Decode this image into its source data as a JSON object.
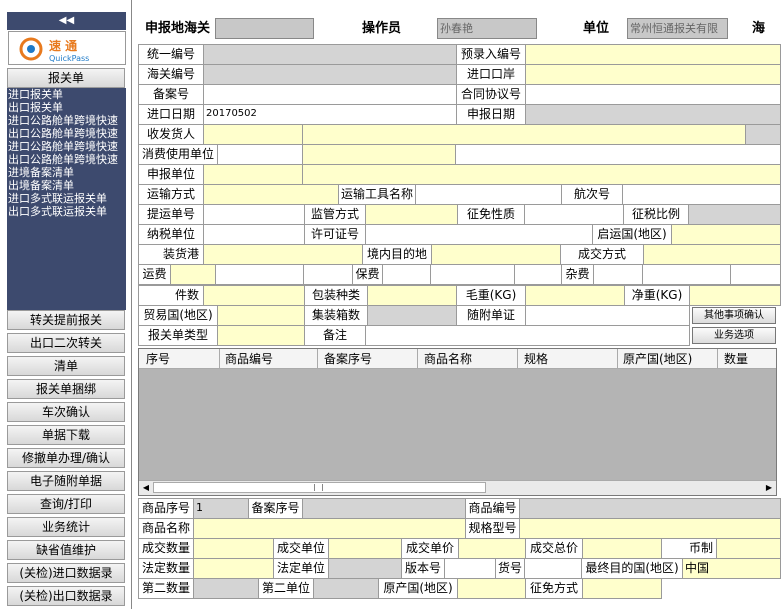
{
  "sidebar": {
    "collapse": "◀◀",
    "logo": {
      "cn": "速 通",
      "en": "QuickPass"
    },
    "section": "报关单",
    "nav_items": [
      "进口报关单",
      "出口报关单",
      "进口公路舱单跨境快速",
      "出口公路舱单跨境快速",
      "进口公路舱单跨境快速",
      "出口公路舱单跨境快速",
      "进境备案清单",
      "出境备案清单",
      "进口多式联运报关单",
      "出口多式联运报关单"
    ],
    "buttons": [
      "转关提前报关",
      "出口二次转关",
      "清单",
      "报关单捆绑",
      "车次确认",
      "单据下载",
      "修撤单办理/确认",
      "电子随附单据",
      "查询/打印",
      "业务统计",
      "缺省值维护",
      "(关检)进口数据录",
      "(关检)出口数据录"
    ]
  },
  "header": {
    "customs_label": "申报地海关",
    "customs_value": "",
    "operator_label": "操作员",
    "operator_value": "孙春艳",
    "unit_label": "单位",
    "unit_value": "常州恒通报关有限",
    "last_label": "海关-"
  },
  "form": {
    "unified_no": "统一编号",
    "pre_entry_no": "预录入编号",
    "customs_no": "海关编号",
    "import_port": "进口口岸",
    "record_no": "备案号",
    "contract_no": "合同协议号",
    "import_date": "进口日期",
    "import_date_value": "20170502",
    "declare_date": "申报日期",
    "consignee": "收发货人",
    "consume_unit": "消费使用单位",
    "declare_unit": "申报单位",
    "transport_mode": "运输方式",
    "transport_name": "运输工具名称",
    "voyage_no": "航次号",
    "bill_no": "提运单号",
    "supervision": "监管方式",
    "tax_nature": "征免性质",
    "tax_ratio": "征税比例",
    "taxpayer": "纳税单位",
    "license_no": "许可证号",
    "origin_country": "启运国(地区)",
    "loading_port": "装货港",
    "destination": "境内目的地",
    "deal_mode": "成交方式",
    "freight": "运费",
    "insurance": "保费",
    "misc_fee": "杂费",
    "packages": "件数",
    "package_type": "包装种类",
    "gross_weight": "毛重(KG)",
    "net_weight": "净重(KG)",
    "trade_country": "贸易国(地区)",
    "container_no": "集装箱数",
    "attached_docs": "随附单证",
    "decl_type": "报关单类型",
    "remarks": "备注",
    "btn_other": "其他事项确认",
    "btn_biz": "业务选项"
  },
  "grid": {
    "columns": [
      "序号",
      "商品编号",
      "备案序号",
      "商品名称",
      "规格",
      "原产国(地区)",
      "数量"
    ]
  },
  "detail": {
    "item_no": "商品序号",
    "item_no_value": "1",
    "record_seq": "备案序号",
    "goods_code": "商品编号",
    "goods_name": "商品名称",
    "spec_model": "规格型号",
    "deal_qty": "成交数量",
    "deal_unit": "成交单位",
    "deal_price": "成交单价",
    "deal_total": "成交总价",
    "currency": "币制",
    "legal_qty": "法定数量",
    "legal_unit": "法定单位",
    "version_no": "版本号",
    "item_code": "货号",
    "final_dest": "最终目的国(地区)",
    "final_dest_value": "中国",
    "second_qty": "第二数量",
    "second_unit": "第二单位",
    "origin": "原产国(地区)",
    "exempt_mode": "征免方式"
  },
  "colors": {
    "nav_bg": "#3d4a6e",
    "required": "#ffffcc",
    "disabled": "#d4d4d4"
  }
}
